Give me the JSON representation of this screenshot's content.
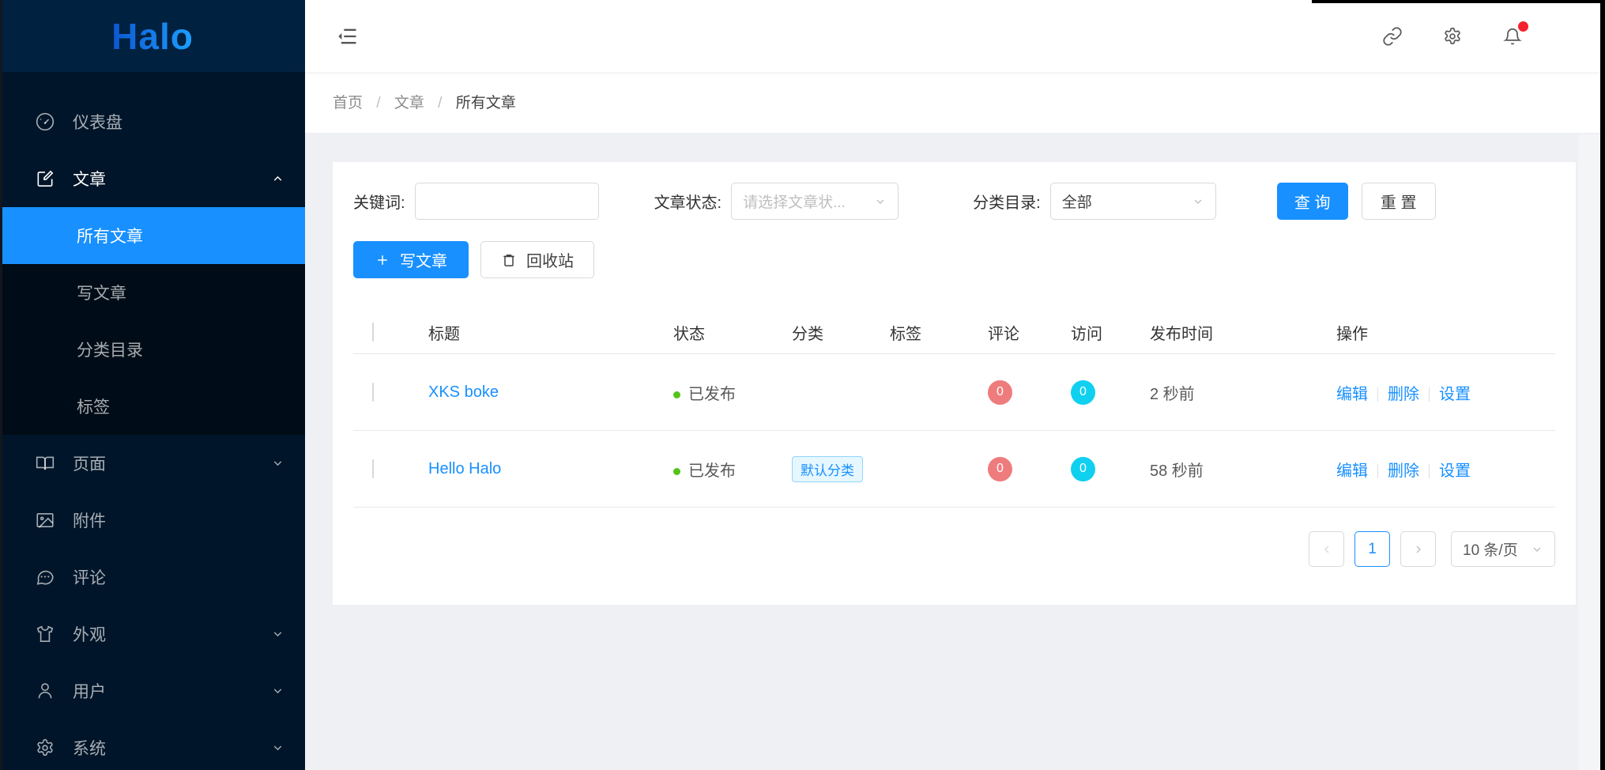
{
  "app": {
    "logo": "Halo"
  },
  "colors": {
    "accent": "#1890ff",
    "sidebar_bg": "#001529",
    "sidebar_logo_bg": "#002140",
    "sidebar_submenu_bg": "#000c17",
    "selected_item_bg": "#1890ff",
    "status_green": "#52c41a",
    "comment_badge": "#ee7c7c",
    "visit_badge": "#10d0f0",
    "notification_dot": "#f5222d",
    "tag_bg": "#e6f7ff",
    "tag_border": "#91d5ff"
  },
  "sidebar": {
    "items": [
      {
        "label": "仪表盘",
        "icon": "dashboard-icon"
      },
      {
        "label": "文章",
        "icon": "edit-square-icon",
        "expanded": true,
        "children": [
          {
            "label": "所有文章",
            "selected": true
          },
          {
            "label": "写文章"
          },
          {
            "label": "分类目录"
          },
          {
            "label": "标签"
          }
        ]
      },
      {
        "label": "页面",
        "icon": "book-icon",
        "has_children": true
      },
      {
        "label": "附件",
        "icon": "image-icon"
      },
      {
        "label": "评论",
        "icon": "comment-icon"
      },
      {
        "label": "外观",
        "icon": "shirt-icon",
        "has_children": true
      },
      {
        "label": "用户",
        "icon": "user-icon",
        "has_children": true
      },
      {
        "label": "系统",
        "icon": "gear-icon",
        "has_children": true
      }
    ]
  },
  "header": {
    "icons": {
      "link": "link-icon",
      "settings": "gear-icon",
      "notifications": "bell-icon"
    },
    "notification_has_unread": true
  },
  "breadcrumb": {
    "separator": "/",
    "items": [
      "首页",
      "文章",
      "所有文章"
    ]
  },
  "filters": {
    "keyword_label": "关键词:",
    "keyword_value": "",
    "status_label": "文章状态:",
    "status_placeholder": "请选择文章状...",
    "category_label": "分类目录:",
    "category_value": "全部",
    "query_button": "查 询",
    "reset_button": "重 置"
  },
  "toolbar": {
    "write_post": "写文章",
    "recycle_bin": "回收站"
  },
  "table": {
    "columns": [
      "标题",
      "状态",
      "分类",
      "标签",
      "评论",
      "访问",
      "发布时间",
      "操作"
    ],
    "rows": [
      {
        "title": "XKS boke",
        "status": "已发布",
        "category": "",
        "tags": "",
        "comments": "0",
        "visits": "0",
        "published": "2 秒前",
        "actions": [
          "编辑",
          "删除",
          "设置"
        ]
      },
      {
        "title": "Hello Halo",
        "status": "已发布",
        "category": "默认分类",
        "tags": "",
        "comments": "0",
        "visits": "0",
        "published": "58 秒前",
        "actions": [
          "编辑",
          "删除",
          "设置"
        ]
      }
    ]
  },
  "pagination": {
    "current_page": "1",
    "page_size": "10 条/页"
  }
}
